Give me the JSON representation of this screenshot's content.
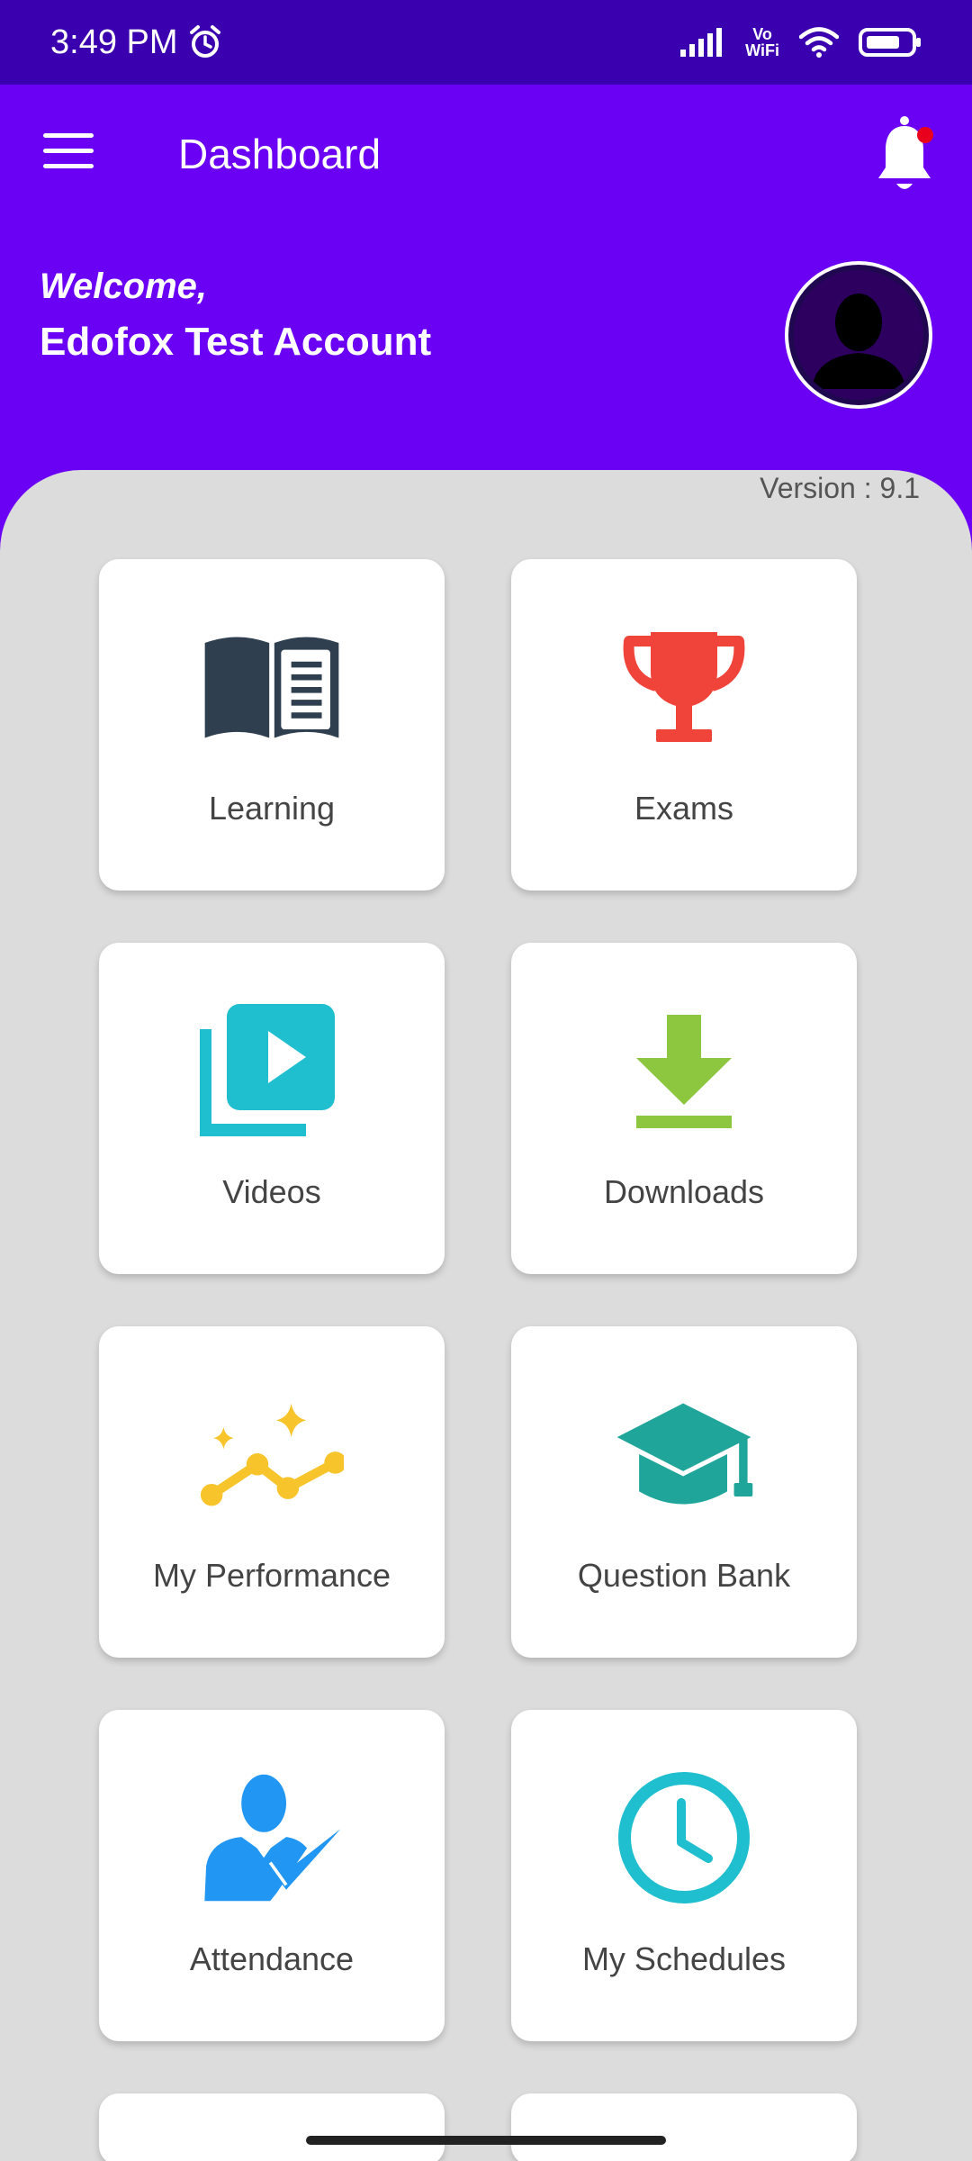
{
  "status_bar": {
    "time": "3:49 PM",
    "vowifi_top": "Vo",
    "vowifi_bottom": "WiFi"
  },
  "app_bar": {
    "title": "Dashboard"
  },
  "welcome": {
    "label": "Welcome,",
    "name": "Edofox Test Account"
  },
  "version": "Version : 9.1",
  "tiles": [
    {
      "label": "Learning",
      "icon": "book-icon",
      "color": "#2f3f4f"
    },
    {
      "label": "Exams",
      "icon": "trophy-icon",
      "color": "#f0443a"
    },
    {
      "label": "Videos",
      "icon": "video-library-icon",
      "color": "#1fbfcf"
    },
    {
      "label": "Downloads",
      "icon": "download-icon",
      "color": "#8dc63f"
    },
    {
      "label": "My Performance",
      "icon": "performance-chart-icon",
      "color": "#f7c52b"
    },
    {
      "label": "Question Bank",
      "icon": "graduation-cap-icon",
      "color": "#20a59a"
    },
    {
      "label": "Attendance",
      "icon": "attendance-icon",
      "color": "#2196f3"
    },
    {
      "label": "My Schedules",
      "icon": "clock-icon",
      "color": "#1fbfcf"
    }
  ],
  "colors": {
    "primary": "#6a00f4",
    "status_bar": "#3a00b0",
    "panel": "#dcdcdc",
    "notification_dot": "#e8001c"
  }
}
